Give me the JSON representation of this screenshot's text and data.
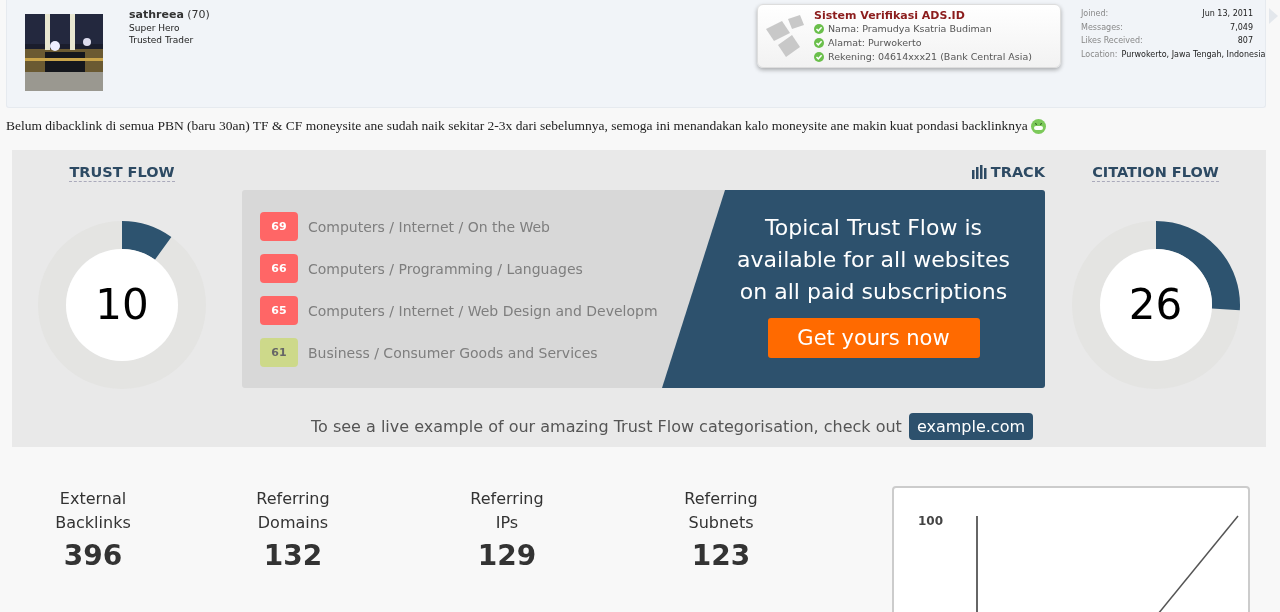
{
  "user": {
    "name": "sathreea",
    "count": "(70)",
    "titles": [
      "Super Hero",
      "Trusted Trader"
    ]
  },
  "verification": {
    "title": "Sistem Verifikasi ADS.ID",
    "items": [
      "Nama: Pramudya Ksatria Budiman",
      "Alamat: Purwokerto",
      "Rekening: 04614xxx21 (Bank Central Asia)"
    ]
  },
  "user_stats": [
    {
      "label": "Joined:",
      "value": "Jun 13, 2011"
    },
    {
      "label": "Messages:",
      "value": "7,049"
    },
    {
      "label": "Likes Received:",
      "value": "807"
    },
    {
      "label": "Location:",
      "value": "Purwokerto, Jawa Tengah, Indonesia"
    }
  ],
  "post_text": "Belum dibacklink di semua PBN (baru 30an) TF & CF moneysite ane sudah naik sekitar 2-3x dari sebelumnya, semoga ini menandakan kalo moneysite ane makin kuat pondasi backlinknya",
  "trust_flow": {
    "title": "TRUST FLOW",
    "value": "10"
  },
  "track": "TRACK",
  "citation_flow": {
    "title": "CITATION FLOW",
    "value": "26"
  },
  "topics": [
    {
      "score": "69",
      "label": "Computers / Internet / On the Web",
      "color": "#ff6666"
    },
    {
      "score": "66",
      "label": "Computers / Programming / Languages",
      "color": "#ff6666"
    },
    {
      "score": "65",
      "label": "Computers / Internet / Web Design and Developm",
      "color": "#ff6666"
    },
    {
      "score": "61",
      "label": "Business / Consumer Goods and Services",
      "color": "#cdd98a"
    }
  ],
  "promo": {
    "text": "Topical Trust Flow is available for all websites on all paid subscriptions",
    "button": "Get yours now"
  },
  "example_note": {
    "text": "To see a live example of our amazing Trust Flow categorisation, check out",
    "link": "example.com"
  },
  "metrics": [
    {
      "label": "External Backlinks",
      "value": "396"
    },
    {
      "label": "Referring Domains",
      "value": "132"
    },
    {
      "label": "Referring IPs",
      "value": "129"
    },
    {
      "label": "Referring Subnets",
      "value": "123"
    }
  ],
  "mini_chart": {
    "y_tick": "100"
  }
}
